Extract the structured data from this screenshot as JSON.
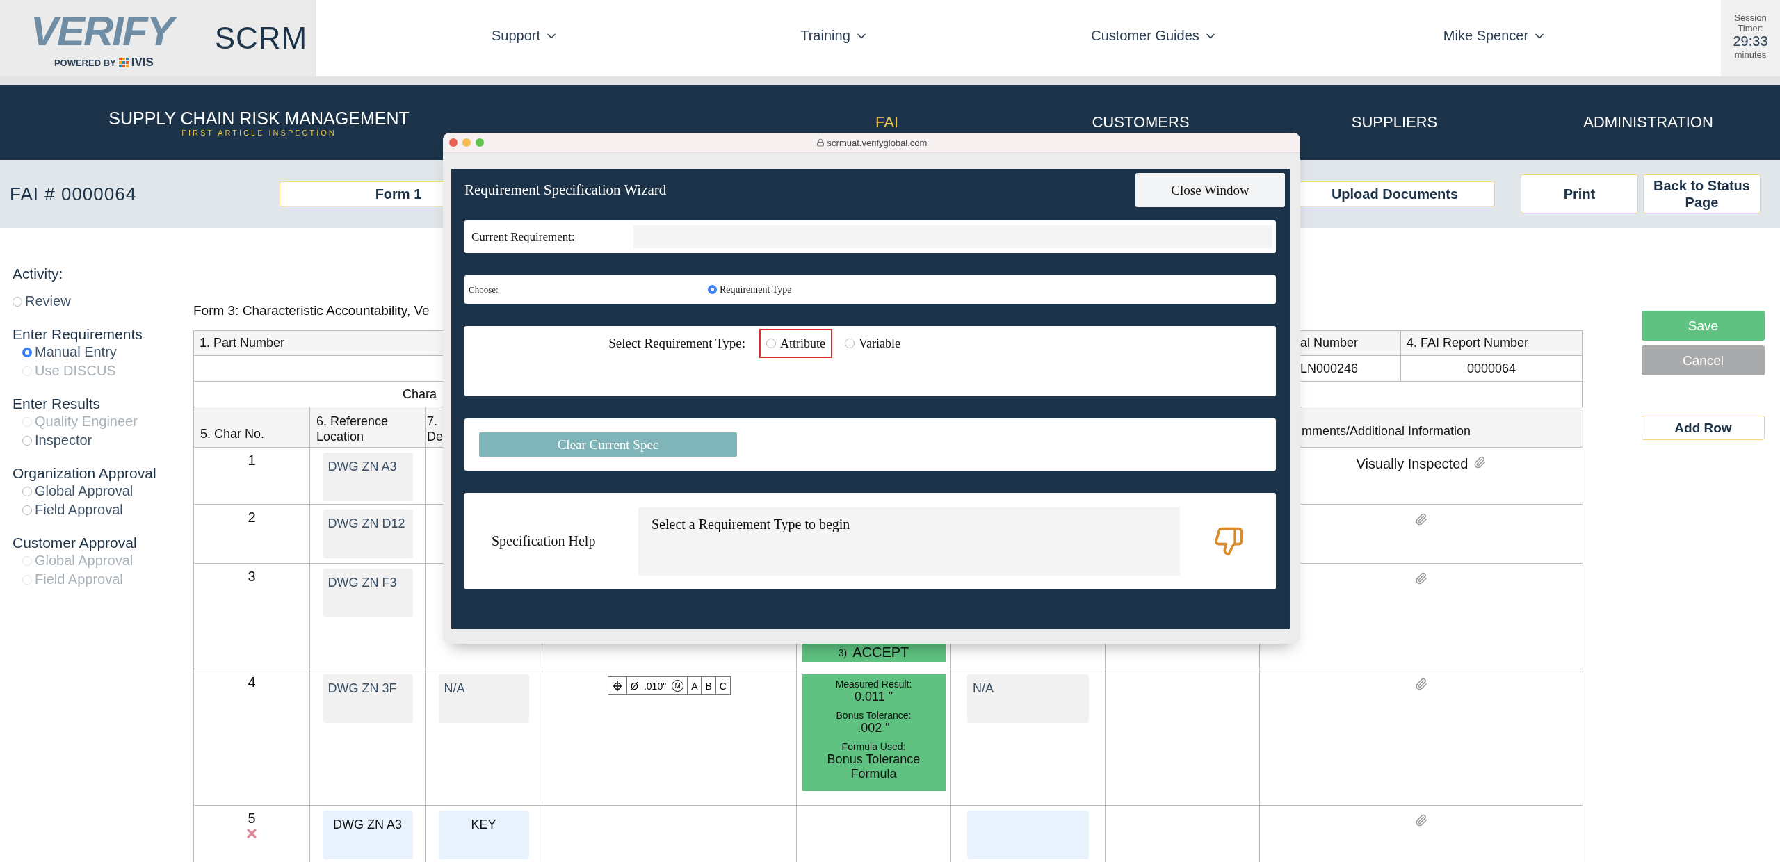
{
  "header": {
    "logo": {
      "brand": "VERIFY",
      "tagline": "POWERED BY",
      "partner": "IVIS"
    },
    "app_name": "SCRM",
    "menu": [
      {
        "label": "Support"
      },
      {
        "label": "Training"
      },
      {
        "label": "Customer Guides"
      },
      {
        "label": "Mike Spencer"
      }
    ],
    "session_timer": {
      "label": "Session Timer:",
      "time": "29:33",
      "unit": "minutes"
    }
  },
  "nav": {
    "title": "SUPPLY CHAIN RISK MANAGEMENT",
    "subtitle": "FIRST ARTICLE INSPECTION",
    "items": [
      {
        "label": "FAI",
        "selected": true
      },
      {
        "label": "CUSTOMERS",
        "selected": false
      },
      {
        "label": "SUPPLIERS",
        "selected": false
      },
      {
        "label": "ADMINISTRATION",
        "selected": false
      }
    ]
  },
  "toolbar": {
    "fai_number": "FAI # 0000064",
    "buttons": [
      {
        "label": "Form 1",
        "kind": "form"
      },
      {
        "label": "Upload Documents",
        "kind": "form"
      },
      {
        "label": "Print",
        "kind": "action"
      },
      {
        "label": "Back to Status Page",
        "kind": "action"
      }
    ]
  },
  "sidebar": {
    "title": "Activity:",
    "groups": [
      {
        "items": [
          {
            "label": "Review",
            "selected": false,
            "disabled": false
          }
        ]
      },
      {
        "title": "Enter Requirements",
        "items": [
          {
            "label": "Manual Entry",
            "selected": true,
            "disabled": false
          },
          {
            "label": "Use DISCUS",
            "selected": false,
            "disabled": true
          }
        ]
      },
      {
        "title": "Enter Results",
        "items": [
          {
            "label": "Quality Engineer",
            "selected": false,
            "disabled": true
          },
          {
            "label": "Inspector",
            "selected": false,
            "disabled": false
          }
        ]
      },
      {
        "title": "Organization Approval",
        "items": [
          {
            "label": "Global Approval",
            "selected": false,
            "disabled": false
          },
          {
            "label": "Field Approval",
            "selected": false,
            "disabled": false
          }
        ]
      },
      {
        "title": "Customer Approval",
        "items": [
          {
            "label": "Global Approval",
            "selected": false,
            "disabled": true
          },
          {
            "label": "Field Approval",
            "selected": false,
            "disabled": true
          }
        ]
      }
    ]
  },
  "form_title": "Form 3: Characteristic Accountability, Ve",
  "table": {
    "header_cells": [
      "1. Part Number",
      "al Number",
      "4. FAI Report Number"
    ],
    "header_values": [
      "LN000246",
      "0000064"
    ],
    "section_title": "Chara",
    "columns": {
      "char_no": "5. Char No.",
      "reference_location": "6. Reference Location",
      "column_7": "7. De",
      "comments": "mments/Additional Information"
    },
    "rows": [
      {
        "kind": "saved",
        "char_no": "1",
        "reference_location": "DWG ZN A3",
        "comments": "Visually Inspected"
      },
      {
        "kind": "saved",
        "char_no": "2",
        "reference_location": "DWG ZN D12"
      },
      {
        "kind": "saved",
        "char_no": "3",
        "reference_location": "DWG ZN F3",
        "result": {
          "number": "3)",
          "status": "ACCEPT"
        }
      },
      {
        "kind": "saved",
        "char_no": "4",
        "reference_location": "DWG ZN 3F",
        "column_7": "N/A",
        "gdt": {
          "diameter": "Ø",
          "tolerance": ".010\"",
          "modifier": "M",
          "datums": [
            "A",
            "B",
            "C"
          ]
        },
        "result_details": [
          {
            "label": "Measured Result:",
            "value": "0.011 \""
          },
          {
            "label": "Bonus Tolerance:",
            "value": ".002 \""
          },
          {
            "label": "Formula Used:",
            "value": "Bonus Tolerance Formula"
          }
        ],
        "column_10": "N/A"
      },
      {
        "kind": "new",
        "char_no": "5",
        "reference_location": "DWG ZN A3",
        "column_7": "KEY"
      }
    ]
  },
  "actions": [
    {
      "label": "Save",
      "kind": "primary"
    },
    {
      "label": "Cancel",
      "kind": "secondary"
    },
    {
      "label": "Add Row",
      "kind": "outline"
    }
  ],
  "popup": {
    "url": "scrmuat.verifyglobal.com",
    "title": "Requirement Specification Wizard",
    "close_button": "Close Window",
    "current_requirement": {
      "label": "Current Requirement:"
    },
    "choose": {
      "label": "Choose:",
      "options": [
        {
          "label": "Requirement Type",
          "selected": true
        }
      ]
    },
    "requirement_type": {
      "label": "Select Requirement Type:",
      "options": [
        {
          "label": "Attribute",
          "selected": false,
          "highlighted": true
        },
        {
          "label": "Variable",
          "selected": false,
          "highlighted": false
        }
      ]
    },
    "clear_button": "Clear Current Spec",
    "help": {
      "label": "Specification Help",
      "text": "Select a Requirement Type to begin"
    }
  }
}
